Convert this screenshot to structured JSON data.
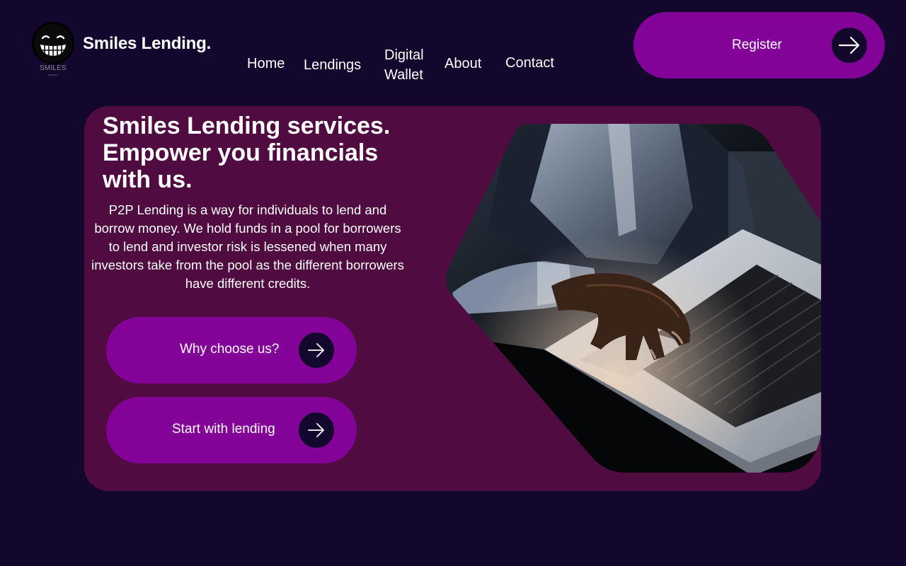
{
  "header": {
    "logo_text": "SMILES",
    "logo_subtext": "LENDING",
    "brand": "Smiles Lending.",
    "nav": {
      "home": "Home",
      "lendings": "Lendings",
      "digital_wallet_line1": "Digital",
      "digital_wallet_line2": "Wallet",
      "about": "About",
      "contact": "Contact"
    },
    "register_label": "Register"
  },
  "hero": {
    "title_line1": "Smiles Lending services.",
    "title_line2": "Empower you financials",
    "title_line3": "with us.",
    "description": "P2P Lending is a way for individuals to lend and borrow money. We hold funds in a pool for borrowers to lend and investor risk is lessened when many investors take from the pool as the different borrowers have different credits.",
    "why_label": "Why choose us?",
    "start_label": "Start with lending"
  },
  "icons": {
    "logo": "grinning-face-icon",
    "arrow": "arrow-right-icon",
    "photo": "laptop-typing-photo"
  },
  "colors": {
    "background": "#13072e",
    "card": "#500b40",
    "button": "#830399",
    "text": "#ffffff"
  }
}
